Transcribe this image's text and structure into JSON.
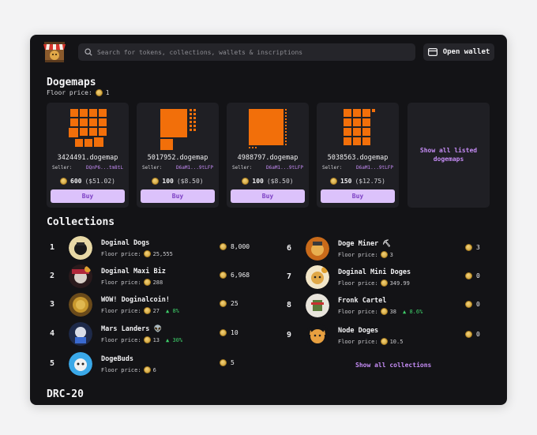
{
  "search": {
    "placeholder": "Search for tokens, collections, wallets & inscriptions"
  },
  "wallet": {
    "label": "Open wallet"
  },
  "dogemaps": {
    "title": "Dogemaps",
    "floor_label": "Floor price:",
    "floor_value": "1",
    "cards": [
      {
        "name": "3424491.dogemap",
        "seller_label": "Seller:",
        "seller": "DQnP6...tm8tL",
        "price": "600",
        "usd": "($51.02)",
        "buy": "Buy"
      },
      {
        "name": "5017952.dogemap",
        "seller_label": "Seller:",
        "seller": "D6aM1...9tLFP",
        "price": "100",
        "usd": "($8.50)",
        "buy": "Buy"
      },
      {
        "name": "4988797.dogemap",
        "seller_label": "Seller:",
        "seller": "D6aM1...9tLFP",
        "price": "100",
        "usd": "($8.50)",
        "buy": "Buy"
      },
      {
        "name": "5038563.dogemap",
        "seller_label": "Seller:",
        "seller": "D6aM1...9tLFP",
        "price": "150",
        "usd": "($12.75)",
        "buy": "Buy"
      }
    ],
    "show_all": "Show all listed dogemaps"
  },
  "collections": {
    "title": "Collections",
    "floor_label": "Floor price:",
    "items": [
      {
        "rank": "1",
        "name": "Doginal Dogs",
        "floor": "25,555",
        "change": "",
        "volume": "8,000"
      },
      {
        "rank": "2",
        "name": "Doginal Maxi Biz",
        "floor": "288",
        "change": "",
        "volume": "6,968"
      },
      {
        "rank": "3",
        "name": "WOW! Doginalcoin!",
        "floor": "27",
        "change": "▲ 8%",
        "volume": "25"
      },
      {
        "rank": "4",
        "name": "Mars Landers 👽",
        "floor": "13",
        "change": "▲ 30%",
        "volume": "10"
      },
      {
        "rank": "5",
        "name": "DogeBuds",
        "floor": "6",
        "change": "",
        "volume": "5"
      },
      {
        "rank": "6",
        "name": "Doge Miner ⛏",
        "floor": "3",
        "change": "",
        "volume": "3"
      },
      {
        "rank": "7",
        "name": "Doginal Mini Doges",
        "floor": "349.99",
        "change": "",
        "volume": "0"
      },
      {
        "rank": "8",
        "name": "Fronk Cartel",
        "floor": "38",
        "change": "▲ 8.6%",
        "volume": "0"
      },
      {
        "rank": "9",
        "name": "Node Doges",
        "floor": "10.5",
        "change": "",
        "volume": "0"
      }
    ],
    "show_all": "Show all collections"
  },
  "drc20": {
    "title": "DRC-20"
  },
  "colors": {
    "accent": "#c58cf5",
    "buy_bg": "#dcc2fb",
    "map_orange": "#f26f0a",
    "positive": "#3ecf6a"
  }
}
